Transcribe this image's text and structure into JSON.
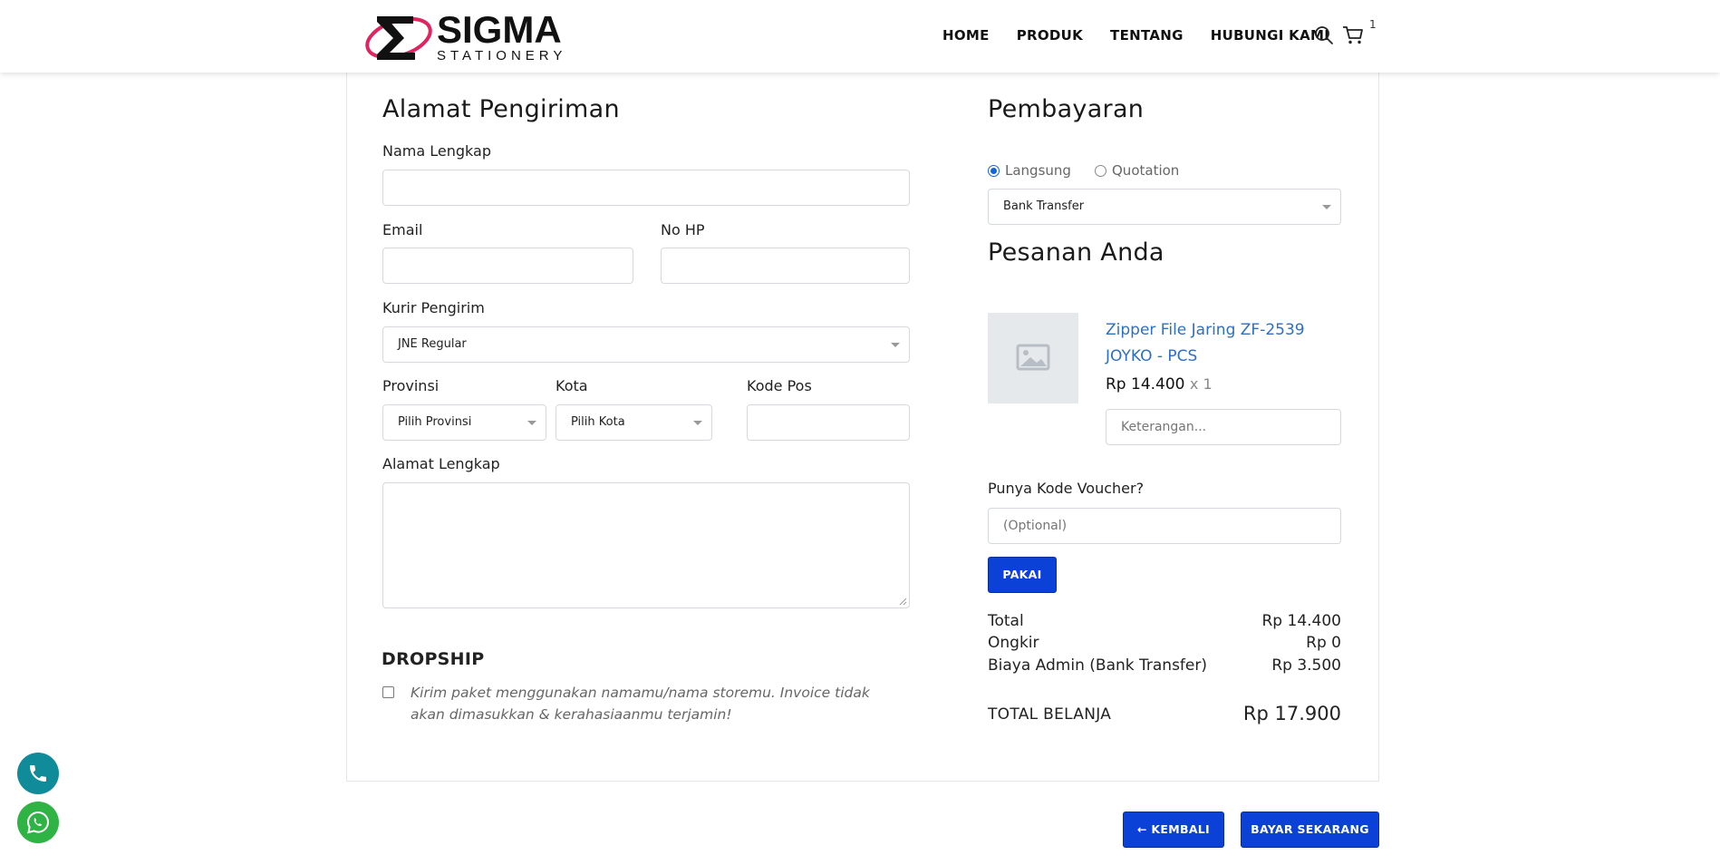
{
  "brand": {
    "name": "SIGMA",
    "tagline": "STATIONERY"
  },
  "nav": {
    "items": [
      "HOME",
      "PRODUK",
      "TENTANG",
      "HUBUNGI KAMI"
    ],
    "cart_count": "1"
  },
  "shipping": {
    "title": "Alamat Pengiriman",
    "name_label": "Nama Lengkap",
    "name_value": "",
    "email_label": "Email",
    "email_value": "",
    "phone_label": "No HP",
    "phone_value": "",
    "courier_label": "Kurir Pengirim",
    "courier_value": "JNE Regular",
    "province_label": "Provinsi",
    "province_value": "Pilih Provinsi",
    "city_label": "Kota",
    "city_value": "Pilih Kota",
    "postcode_label": "Kode Pos",
    "postcode_value": "",
    "address_label": "Alamat Lengkap",
    "address_value": ""
  },
  "dropship": {
    "title": "DROPSHIP",
    "checkbox_text": "Kirim paket menggunakan namamu/nama storemu. Invoice tidak akan dimasukkan & kerahasiaanmu terjamin!",
    "checked": false
  },
  "payment": {
    "title": "Pembayaran",
    "options": [
      "Langsung",
      "Quotation"
    ],
    "selected_option": "Langsung",
    "method_value": "Bank Transfer"
  },
  "order": {
    "title": "Pesanan Anda",
    "items": [
      {
        "name": "Zipper File Jaring ZF-2539 JOYKO - PCS",
        "price": "Rp 14.400",
        "qty": "x 1",
        "note_placeholder": "Keterangan..."
      }
    ]
  },
  "voucher": {
    "label": "Punya Kode Voucher?",
    "placeholder": "(Optional)",
    "apply_label": "PAKAI"
  },
  "summary": {
    "rows": [
      {
        "label": "Total",
        "value": "Rp 14.400"
      },
      {
        "label": "Ongkir",
        "value": "Rp 0"
      },
      {
        "label": "Biaya Admin (Bank Transfer)",
        "value": "Rp 3.500"
      }
    ],
    "grand_label": "TOTAL BELANJA",
    "grand_value": "Rp 17.900"
  },
  "actions": {
    "back_label": "KEMBALI",
    "pay_label": "BAYAR SEKARANG"
  },
  "colors": {
    "primary": "#0b41d6",
    "link": "#2d6fc4",
    "phone_fab": "#0f8b9a",
    "whatsapp_fab": "#2fb344",
    "logo_red": "#e0245e"
  }
}
